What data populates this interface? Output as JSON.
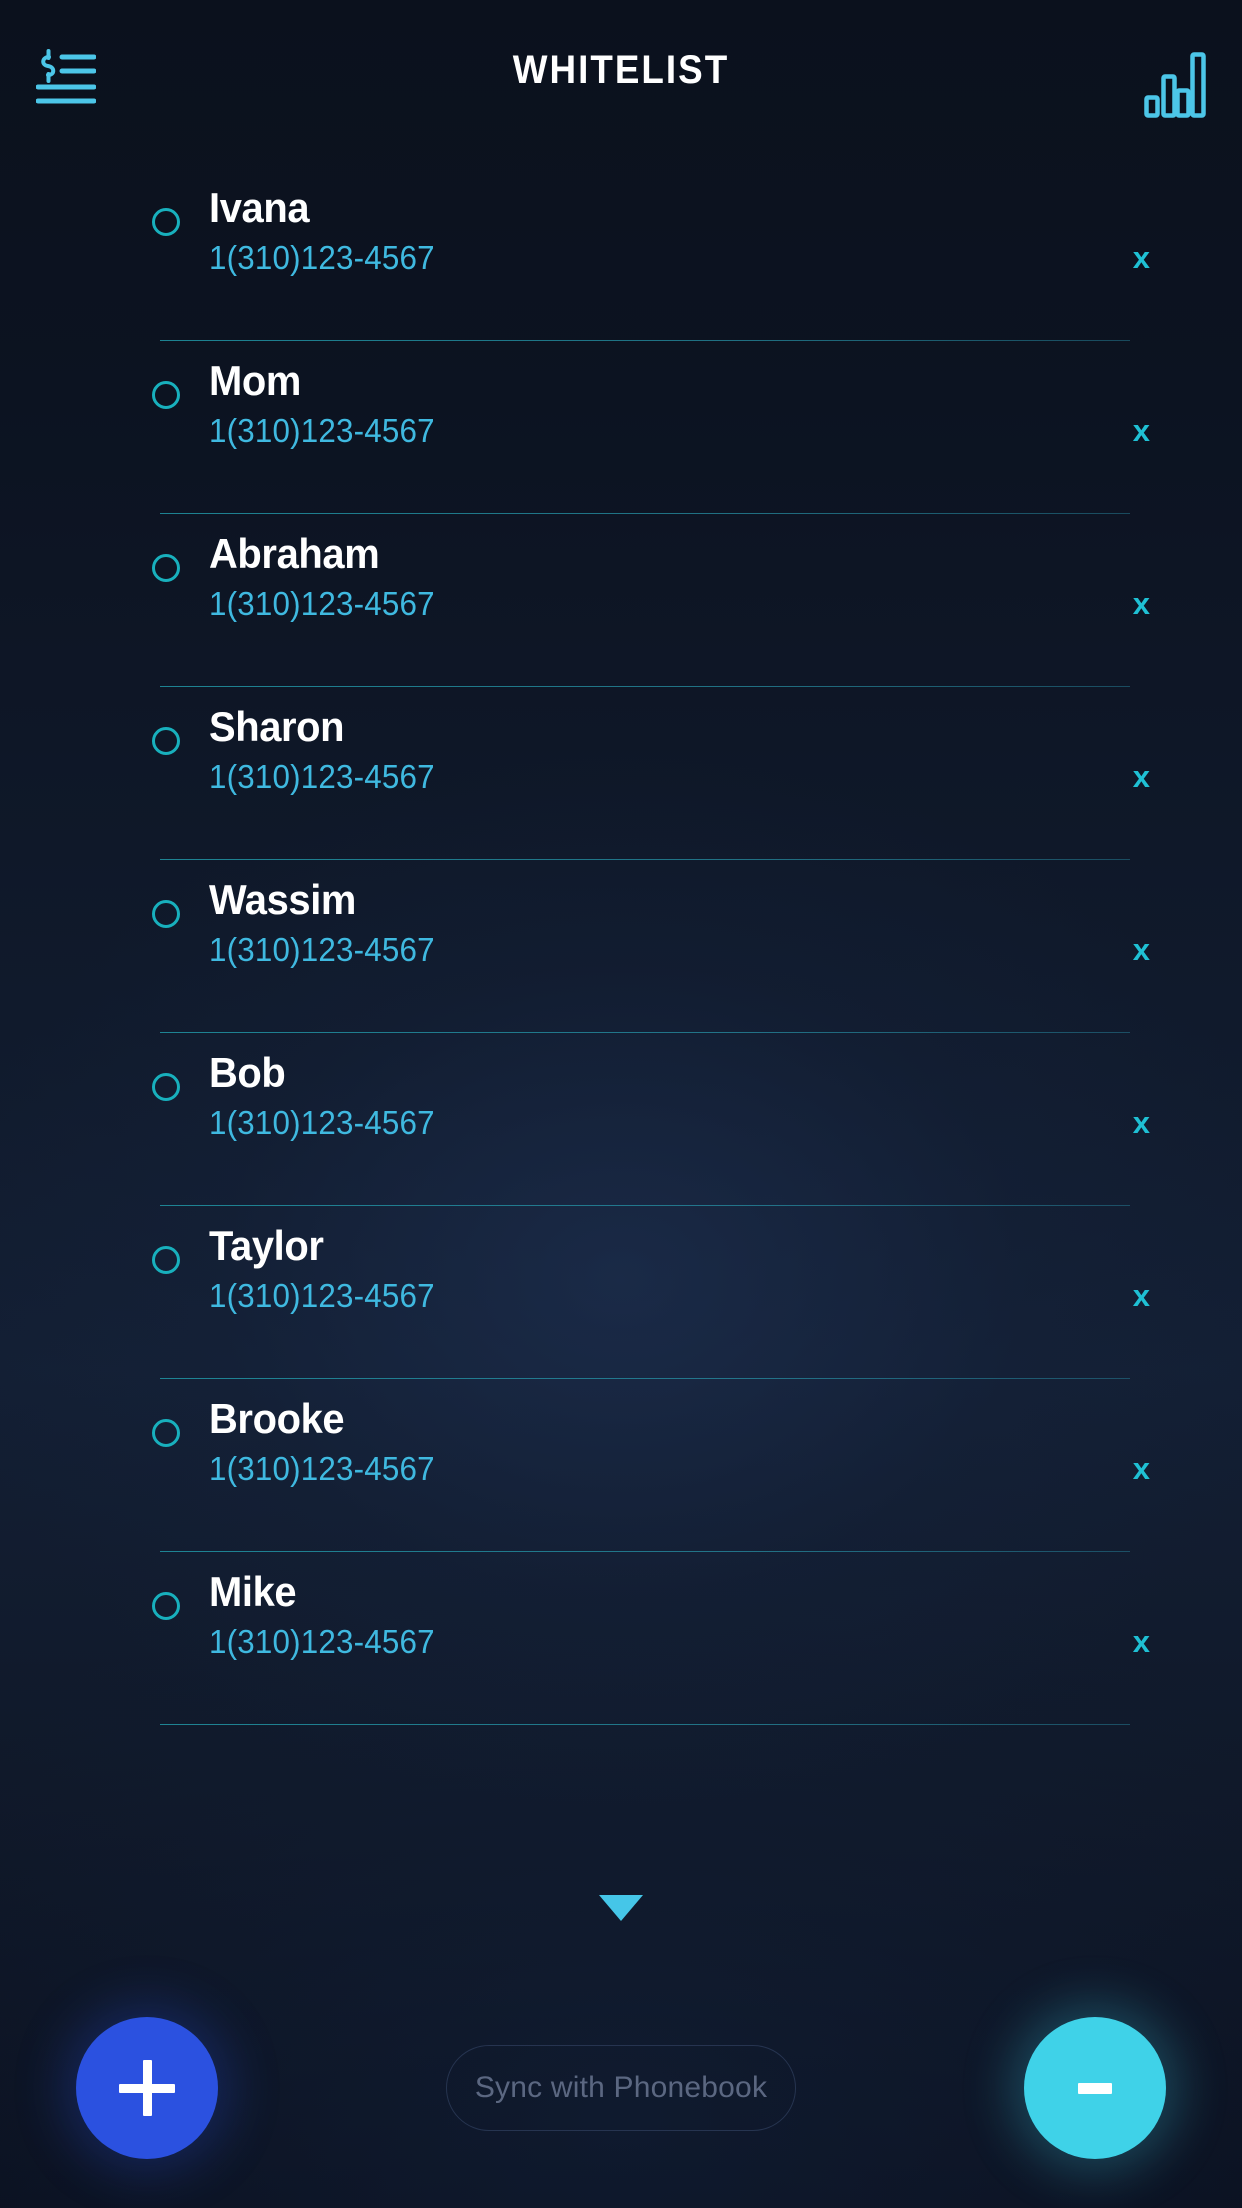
{
  "header": {
    "title": "WHITELIST",
    "menu_icon": "dollar-list-menu-icon",
    "stats_icon": "bar-chart-icon"
  },
  "colors": {
    "accent_cyan": "#3fd2e8",
    "accent_blue": "#2b51e0",
    "phone_text": "#3fb9e0",
    "divider": "#2096a5",
    "name_text": "#ffffff",
    "background_dark": "#0c1320"
  },
  "contacts": [
    {
      "name": "Ivana",
      "phone": "1(310)123-4567",
      "selected": false,
      "delete_label": "x"
    },
    {
      "name": "Mom",
      "phone": "1(310)123-4567",
      "selected": false,
      "delete_label": "x"
    },
    {
      "name": "Abraham",
      "phone": "1(310)123-4567",
      "selected": false,
      "delete_label": "x"
    },
    {
      "name": "Sharon",
      "phone": "1(310)123-4567",
      "selected": false,
      "delete_label": "x"
    },
    {
      "name": "Wassim",
      "phone": "1(310)123-4567",
      "selected": false,
      "delete_label": "x"
    },
    {
      "name": "Bob",
      "phone": "1(310)123-4567",
      "selected": false,
      "delete_label": "x"
    },
    {
      "name": "Taylor",
      "phone": "1(310)123-4567",
      "selected": false,
      "delete_label": "x"
    },
    {
      "name": "Brooke",
      "phone": "1(310)123-4567",
      "selected": false,
      "delete_label": "x"
    },
    {
      "name": "Mike",
      "phone": "1(310)123-4567",
      "selected": false,
      "delete_label": "x"
    }
  ],
  "expander": {
    "icon": "chevron-down-icon"
  },
  "bottom_bar": {
    "add_label": "+",
    "add_icon": "plus-icon",
    "sync_label": "Sync with Phonebook",
    "remove_label": "-",
    "remove_icon": "minus-icon"
  }
}
